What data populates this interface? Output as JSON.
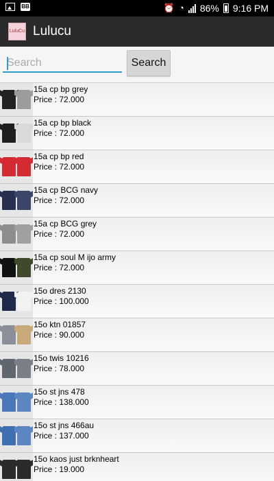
{
  "status_bar": {
    "battery": "86%",
    "time": "9:16 PM"
  },
  "app": {
    "title": "Lulucu",
    "logo_text": "LuluCu"
  },
  "search": {
    "placeholder": "Search",
    "value": "",
    "button_label": "Search"
  },
  "products": [
    {
      "name": "15a cp bp grey",
      "price": "Price : 72.000",
      "colors": [
        "#222222",
        "#9c9c9c"
      ]
    },
    {
      "name": "15a cp bp black",
      "price": "Price : 72.000",
      "colors": [
        "#1e1e1e",
        "#d9d9d9"
      ]
    },
    {
      "name": "15a cp bp red",
      "price": "Price : 72.000",
      "colors": [
        "#d42a32",
        "#d42a32"
      ]
    },
    {
      "name": "15a cp BCG navy",
      "price": "Price : 72.000",
      "colors": [
        "#27304f",
        "#3b4569"
      ]
    },
    {
      "name": "15a cp BCG grey",
      "price": "Price : 72.000",
      "colors": [
        "#8d8d8d",
        "#a0a0a0"
      ]
    },
    {
      "name": "15a cp soul M ijo army",
      "price": "Price : 72.000",
      "colors": [
        "#111111",
        "#3f4a2c"
      ]
    },
    {
      "name": "15o dres 2130",
      "price": "Price : 100.000",
      "colors": [
        "#1f2a4a",
        "#f2f2f2"
      ]
    },
    {
      "name": "15o ktn 01857",
      "price": "Price : 90.000",
      "colors": [
        "#8a8f9a",
        "#c8a97a"
      ]
    },
    {
      "name": "15o twis 10216",
      "price": "Price : 78.000",
      "colors": [
        "#5f6670",
        "#7a7f88"
      ]
    },
    {
      "name": "15o st jns 478",
      "price": "Price : 138.000",
      "colors": [
        "#4a78b8",
        "#5b86c2"
      ]
    },
    {
      "name": "15o st jns 466au",
      "price": "Price : 137.000",
      "colors": [
        "#3f6fae",
        "#5b86c2"
      ]
    },
    {
      "name": "15o kaos just brknheart",
      "price": "Price : 19.000",
      "colors": [
        "#2b2b2b",
        "#2b2b2b"
      ]
    }
  ]
}
